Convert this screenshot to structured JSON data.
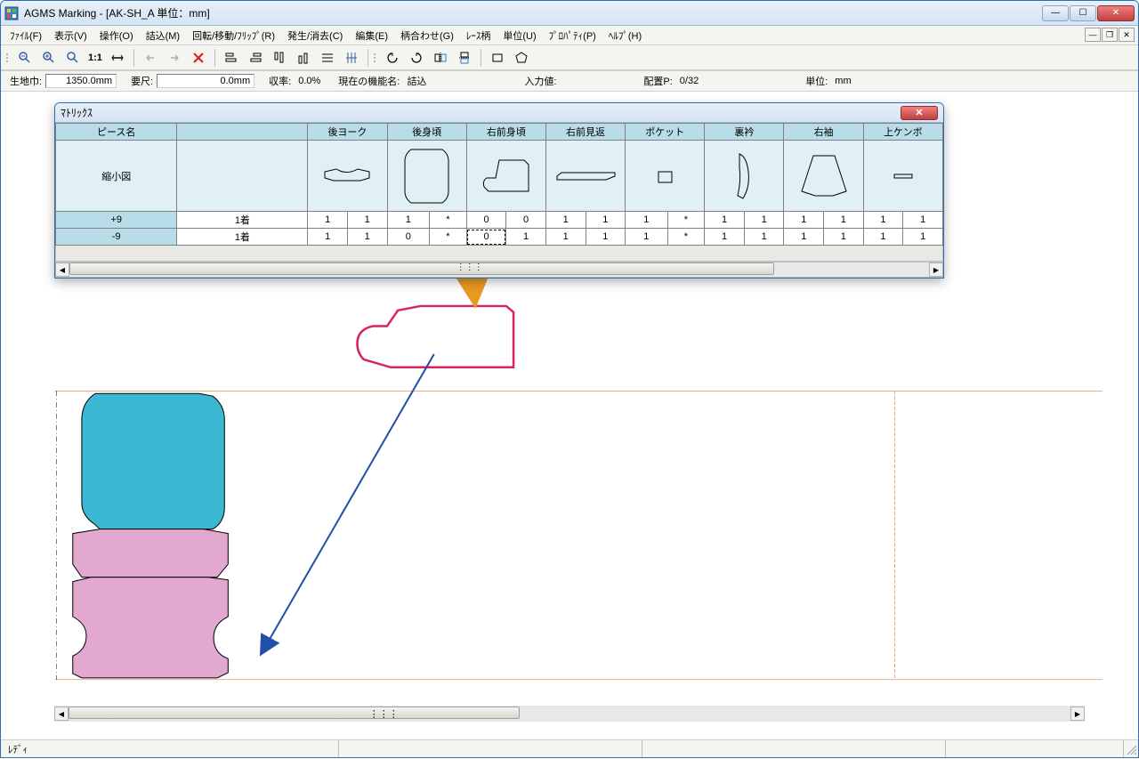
{
  "title": "AGMS Marking - [AK-SH_A  単位：mm]",
  "menu": [
    "ﾌｧｲﾙ(F)",
    "表示(V)",
    "操作(O)",
    "詰込(M)",
    "回転/移動/ﾌﾘｯﾌﾟ(R)",
    "発生/消去(C)",
    "編集(E)",
    "柄合わせ(G)",
    "ﾚｰｽ柄",
    "単位(U)",
    "ﾌﾟﾛﾊﾟﾃｨ(P)",
    "ﾍﾙﾌﾟ(H)"
  ],
  "status": {
    "fabric_width_label": "生地巾:",
    "fabric_width": "1350.0mm",
    "req_len_label": "要尺:",
    "req_len": "0.0mm",
    "eff_label": "収率:",
    "eff": "0.0%",
    "mode_label": "現在の機能名:",
    "mode": "詰込",
    "input_label": "入力値:",
    "placement_label": "配置P:",
    "placement": "0/32",
    "unit_label": "単位:",
    "unit": "mm"
  },
  "matrix": {
    "title": "ﾏﾄﾘｯｸｽ",
    "cols": [
      "ピース名",
      "",
      "後ヨーク",
      "後身頃",
      "右前身頃",
      "右前見返",
      "ポケット",
      "裏衿",
      "右袖",
      "上ケンボ"
    ],
    "thumb_label": "縮小図",
    "rows": [
      {
        "label": "+9",
        "cells": [
          "1着",
          "1",
          "1",
          "1",
          "*",
          "0",
          "0",
          "1",
          "1",
          "1",
          "*",
          "1",
          "1",
          "1",
          "1",
          "1",
          "1"
        ]
      },
      {
        "label": "-9",
        "cells": [
          "1着",
          "1",
          "1",
          "0",
          "*",
          "0",
          "1",
          "1",
          "1",
          "1",
          "*",
          "1",
          "1",
          "1",
          "1",
          "1",
          "1"
        ]
      }
    ]
  },
  "bottom_status": "ﾚﾃﾞｨ"
}
